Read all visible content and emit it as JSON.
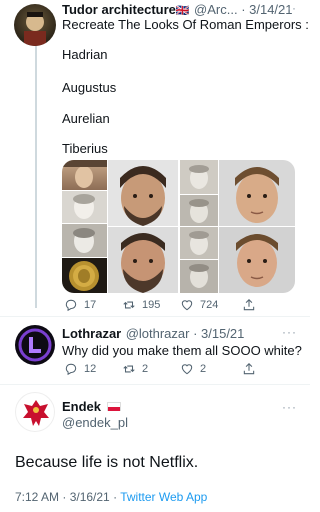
{
  "tweet1": {
    "author_name": "Tudor architecture",
    "flag": "🇬🇧",
    "handle_date": "@Arc... · 3/14/21",
    "more": "···",
    "lines": [
      "Recreate The Looks Of Roman Emperors :",
      "Hadrian",
      "Augustus",
      "Aurelian",
      "Tiberius"
    ],
    "reply_count": "17",
    "retweet_count": "195",
    "like_count": "724"
  },
  "tweet2": {
    "author_name": "Lothrazar",
    "handle_date": "@lothrazar · 3/15/21",
    "more": "···",
    "text": "Why did you make them all SOOO white?",
    "reply_count": "12",
    "retweet_count": "2",
    "like_count": "2"
  },
  "tweet3": {
    "author_name": "Endek",
    "handle": "@endek_pl",
    "more": "···",
    "text": "Because life is not Netflix.",
    "time": "7:12 AM · 3/16/21 · ",
    "source": "Twitter Web App"
  },
  "colors": {
    "text": "#0f1419",
    "secondary": "#536471",
    "link": "#1d9bf0",
    "line": "#cfd9de"
  },
  "icons": [
    "reply-icon",
    "retweet-icon",
    "like-icon",
    "share-icon"
  ]
}
